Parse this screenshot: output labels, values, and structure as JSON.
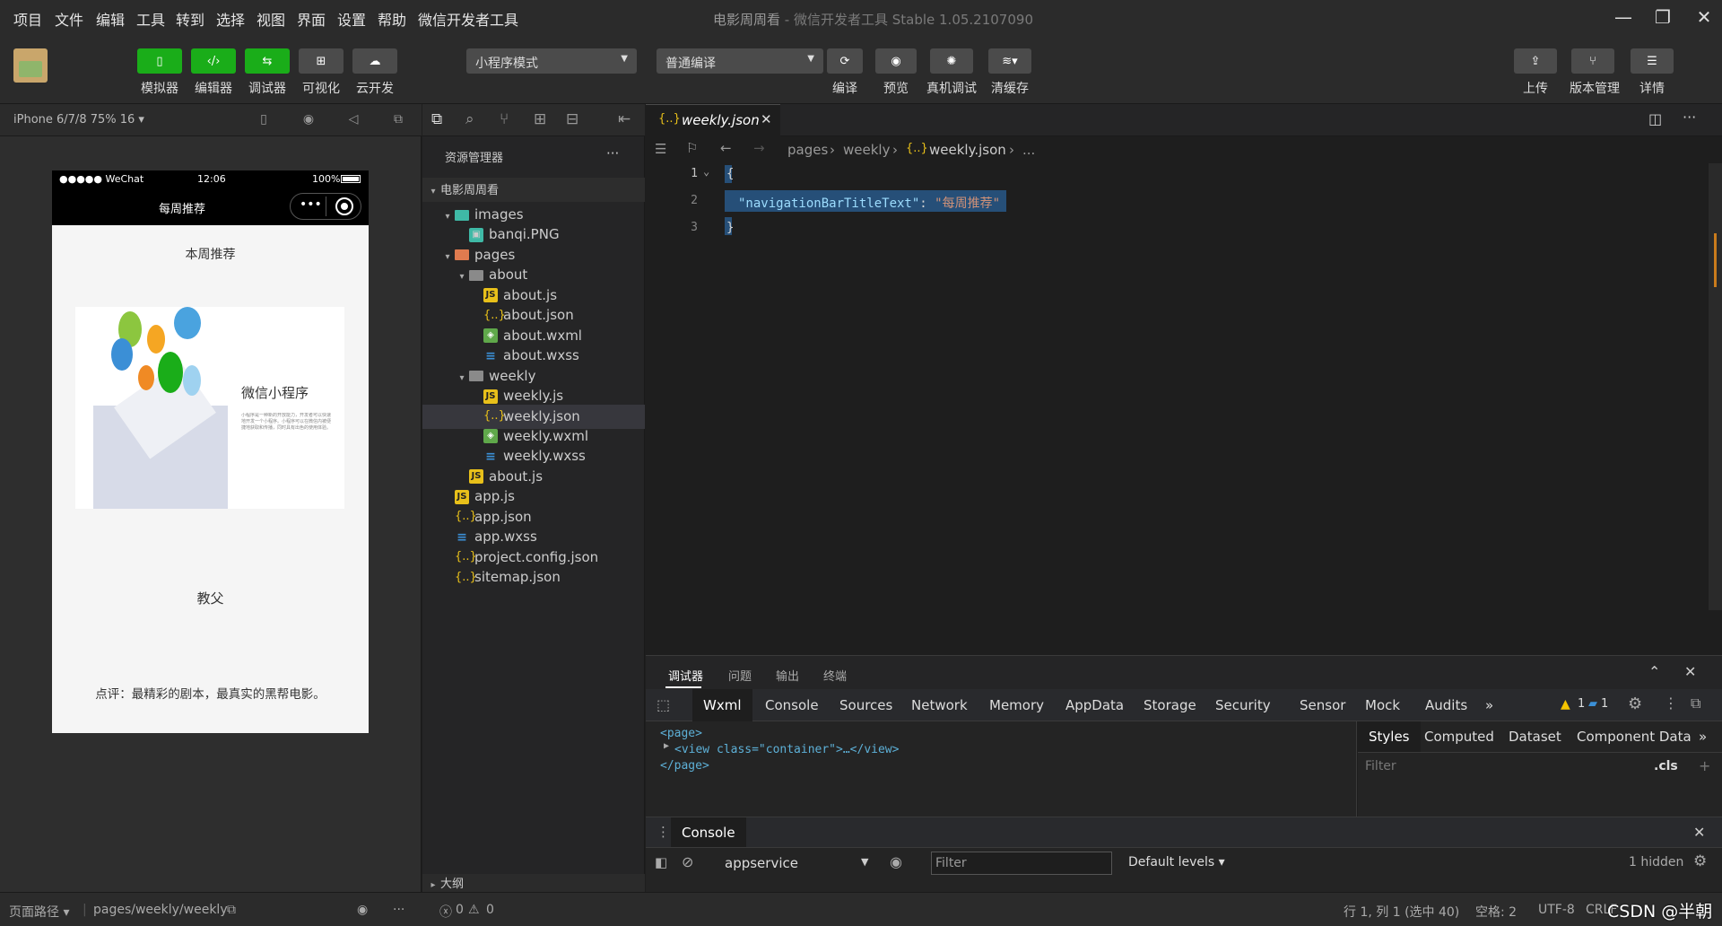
{
  "menubar": {
    "items": [
      "项目",
      "文件",
      "编辑",
      "工具",
      "转到",
      "选择",
      "视图",
      "界面",
      "设置",
      "帮助",
      "微信开发者工具"
    ],
    "title": "电影周周看",
    "title_sub": " - 微信开发者工具 Stable 1.05.2107090",
    "min_icon": "minimize-icon",
    "max_icon": "maximize-icon",
    "close_icon": "close-icon"
  },
  "toolbar": {
    "simulator": "模拟器",
    "editor": "编辑器",
    "debugger": "调试器",
    "visual": "可视化",
    "cloud": "云开发",
    "mode_select": "小程序模式",
    "compile_select": "普通编译",
    "compile": "编译",
    "preview": "预览",
    "real_debug": "真机调试",
    "clear_cache": "清缓存",
    "upload": "上传",
    "version": "版本管理",
    "details": "详情"
  },
  "simulator": {
    "device": "iPhone 6/7/8 75% 16 ▾",
    "status_left": "●●●●● WeChat",
    "status_time": "12:06",
    "status_battery": "100%",
    "nav_title": "每周推荐",
    "heading": "本周推荐",
    "banner_title": "微信小程序",
    "banner_desc": "小程序是一种新的开放能力，开发者可以快速地开发一个小程序。小程序可以在微信内被便捷地获取和传播，同时具有出色的使用体验。",
    "movie": "教父",
    "comment": "点评：最精彩的剧本，最真实的黑帮电影。"
  },
  "explorer": {
    "title": "资源管理器",
    "more": "···",
    "project": "电影周周看",
    "outline": "大纲",
    "items": [
      {
        "label": "images",
        "type": "folder-img",
        "depth": 1,
        "arrow": "▾"
      },
      {
        "label": "banqi.PNG",
        "type": "png",
        "depth": 2,
        "arrow": ""
      },
      {
        "label": "pages",
        "type": "folder-pages",
        "depth": 1,
        "arrow": "▾"
      },
      {
        "label": "about",
        "type": "folder",
        "depth": 2,
        "arrow": "▾"
      },
      {
        "label": "about.js",
        "type": "js",
        "depth": 3,
        "arrow": ""
      },
      {
        "label": "about.json",
        "type": "json",
        "depth": 3,
        "arrow": ""
      },
      {
        "label": "about.wxml",
        "type": "wxml",
        "depth": 3,
        "arrow": ""
      },
      {
        "label": "about.wxss",
        "type": "wxss",
        "depth": 3,
        "arrow": ""
      },
      {
        "label": "weekly",
        "type": "folder",
        "depth": 2,
        "arrow": "▾"
      },
      {
        "label": "weekly.js",
        "type": "js",
        "depth": 3,
        "arrow": ""
      },
      {
        "label": "weekly.json",
        "type": "json",
        "depth": 3,
        "arrow": "",
        "selected": true
      },
      {
        "label": "weekly.wxml",
        "type": "wxml",
        "depth": 3,
        "arrow": ""
      },
      {
        "label": "weekly.wxss",
        "type": "wxss",
        "depth": 3,
        "arrow": ""
      },
      {
        "label": "about.js",
        "type": "js",
        "depth": 2,
        "arrow": ""
      },
      {
        "label": "app.js",
        "type": "js",
        "depth": 1,
        "arrow": ""
      },
      {
        "label": "app.json",
        "type": "json",
        "depth": 1,
        "arrow": ""
      },
      {
        "label": "app.wxss",
        "type": "wxss",
        "depth": 1,
        "arrow": ""
      },
      {
        "label": "project.config.json",
        "type": "json",
        "depth": 1,
        "arrow": ""
      },
      {
        "label": "sitemap.json",
        "type": "json",
        "depth": 1,
        "arrow": ""
      }
    ]
  },
  "editor": {
    "tab": "weekly.json",
    "breadcrumbs": [
      "pages",
      "weekly",
      "weekly.json",
      "..."
    ],
    "lines": [
      {
        "num": "1",
        "text": "{"
      },
      {
        "num": "2",
        "key": "\"navigationBarTitleText\"",
        "colon": ": ",
        "value": "\"每周推荐\""
      },
      {
        "num": "3",
        "text": "}"
      }
    ]
  },
  "debug": {
    "tabs": [
      "调试器",
      "问题",
      "输出",
      "终端"
    ],
    "devtools_tabs": [
      "Wxml",
      "Console",
      "Sources",
      "Network",
      "Memory",
      "AppData",
      "Storage",
      "Security",
      "Sensor",
      "Mock",
      "Audits"
    ],
    "more": "»",
    "warn_count": "1",
    "info_count": "1",
    "wxml_lines": [
      "<page>",
      "<view class=\"container\">…</view>",
      "</page>"
    ],
    "styles_tabs": [
      "Styles",
      "Computed",
      "Dataset",
      "Component Data"
    ],
    "styles_filter": "Filter",
    "cls": ".cls",
    "plus": "+",
    "console_tab": "Console",
    "context": "appservice",
    "console_filter": "Filter",
    "levels": "Default levels ▾",
    "hidden": "1 hidden"
  },
  "statusbar": {
    "path_label": "页面路径 ▾",
    "path": "pages/weekly/weekly",
    "errors": "0",
    "warnings": "0",
    "cursor": "行 1, 列 1 (选中 40)",
    "spaces": "空格: 2",
    "encoding": "UTF-8",
    "eol": "CRLF",
    "watermark": "CSDN @半朝"
  }
}
